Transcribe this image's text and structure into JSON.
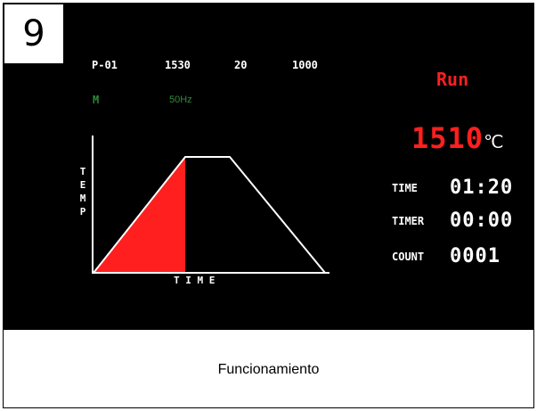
{
  "step_number": "9",
  "header": {
    "program": "P-01",
    "target_temp": "1530",
    "rate": "20",
    "hold": "1000",
    "mode": "M",
    "frequency": "50Hz"
  },
  "status": "Run",
  "current_temp": {
    "value": "1510",
    "unit": "℃"
  },
  "stats": [
    {
      "label": "TIME",
      "value": "01:20"
    },
    {
      "label": "TIMER",
      "value": "00:00"
    },
    {
      "label": "COUNT",
      "value": "0001"
    }
  ],
  "graph": {
    "y_label": "TEMP",
    "x_label": "T I M E"
  },
  "caption": "Funcionamiento",
  "colors": {
    "screen_bg": "#000000",
    "run_red": "#ff1f1f",
    "mode_green": "#2e8b3a",
    "curve_white": "#ffffff"
  }
}
